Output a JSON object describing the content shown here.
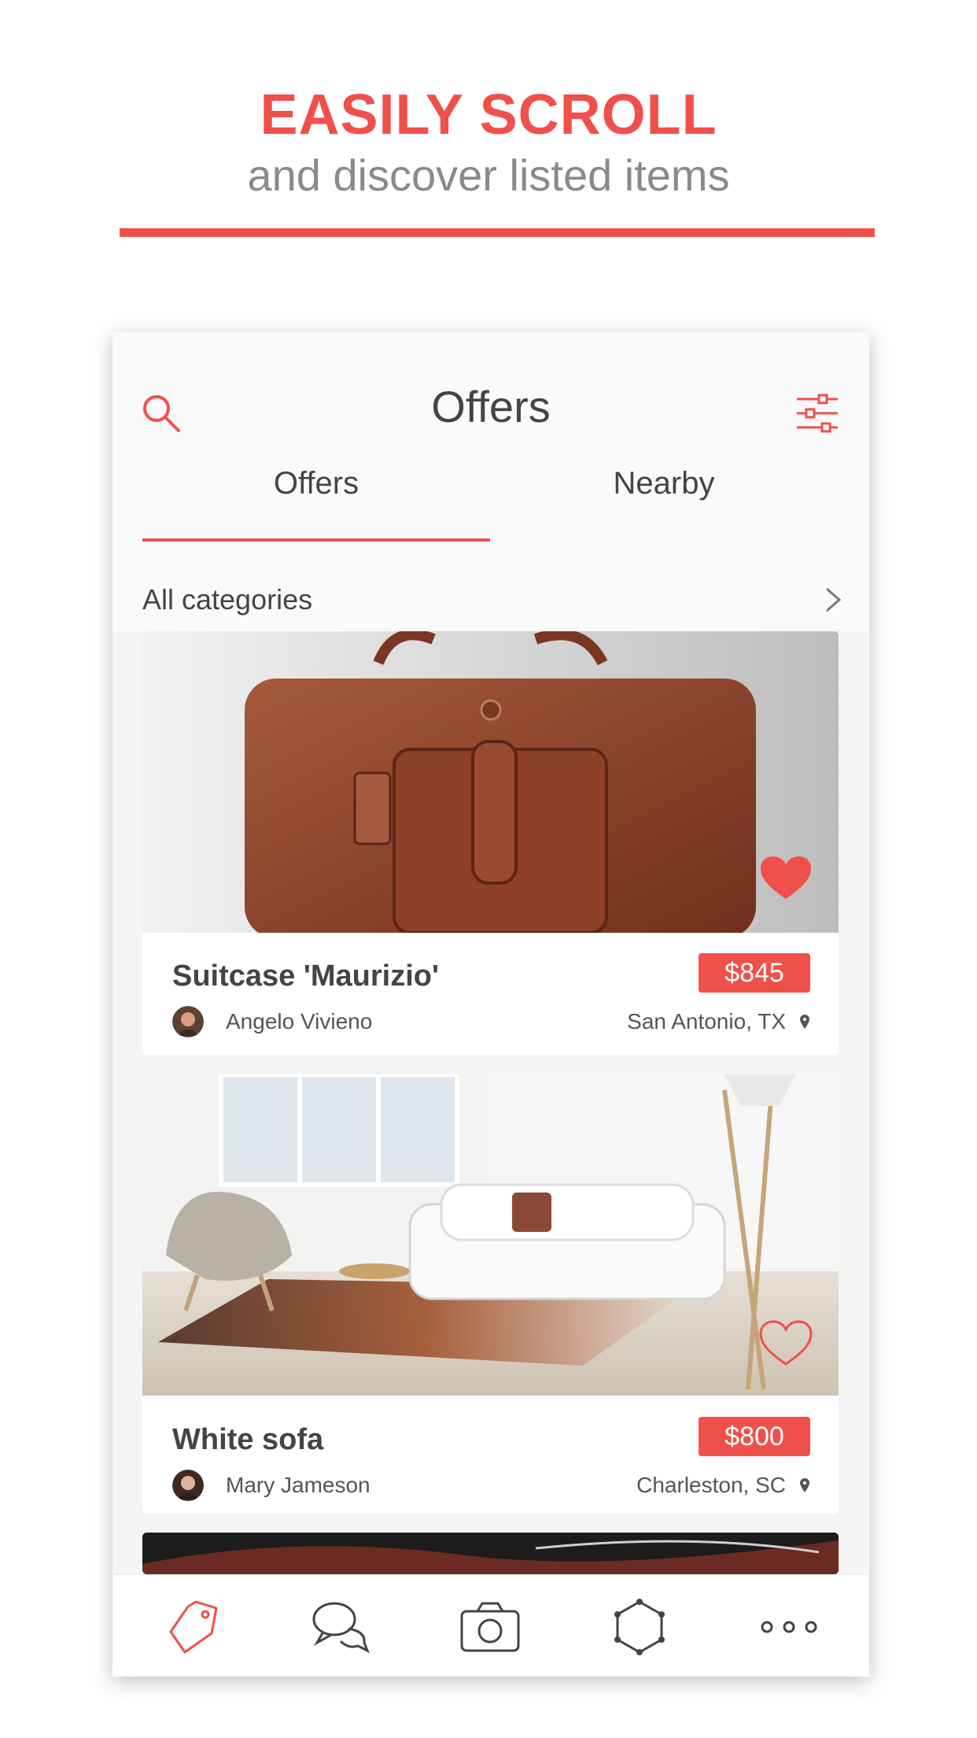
{
  "promo": {
    "headline": "EASILY SCROLL",
    "subheadline": "and discover listed items",
    "accent_color": "#f0504a"
  },
  "app": {
    "title": "Offers",
    "search_icon": "search-icon",
    "filter_icon": "filter-icon",
    "tabs": [
      {
        "label": "Offers",
        "selected": true
      },
      {
        "label": "Nearby",
        "selected": false
      }
    ],
    "categories": {
      "label": "All categories",
      "icon": "chevron-right-icon"
    }
  },
  "listings": [
    {
      "title": "Suitcase 'Maurizio'",
      "price": "$845",
      "seller": "Angelo Vivieno",
      "location": "San Antonio, TX",
      "favorited": true,
      "image": "brown leather bag"
    },
    {
      "title": "White sofa",
      "price": "$800",
      "seller": "Mary Jameson",
      "location": "Charleston, SC",
      "favorited": false,
      "image": "white sofa in living room"
    }
  ],
  "tabbar": {
    "items": [
      {
        "icon": "tag-icon",
        "active": true
      },
      {
        "icon": "chat-icon",
        "active": false
      },
      {
        "icon": "camera-icon",
        "active": false
      },
      {
        "icon": "hexagon-icon",
        "active": false
      },
      {
        "icon": "more-icon",
        "active": false
      }
    ]
  }
}
